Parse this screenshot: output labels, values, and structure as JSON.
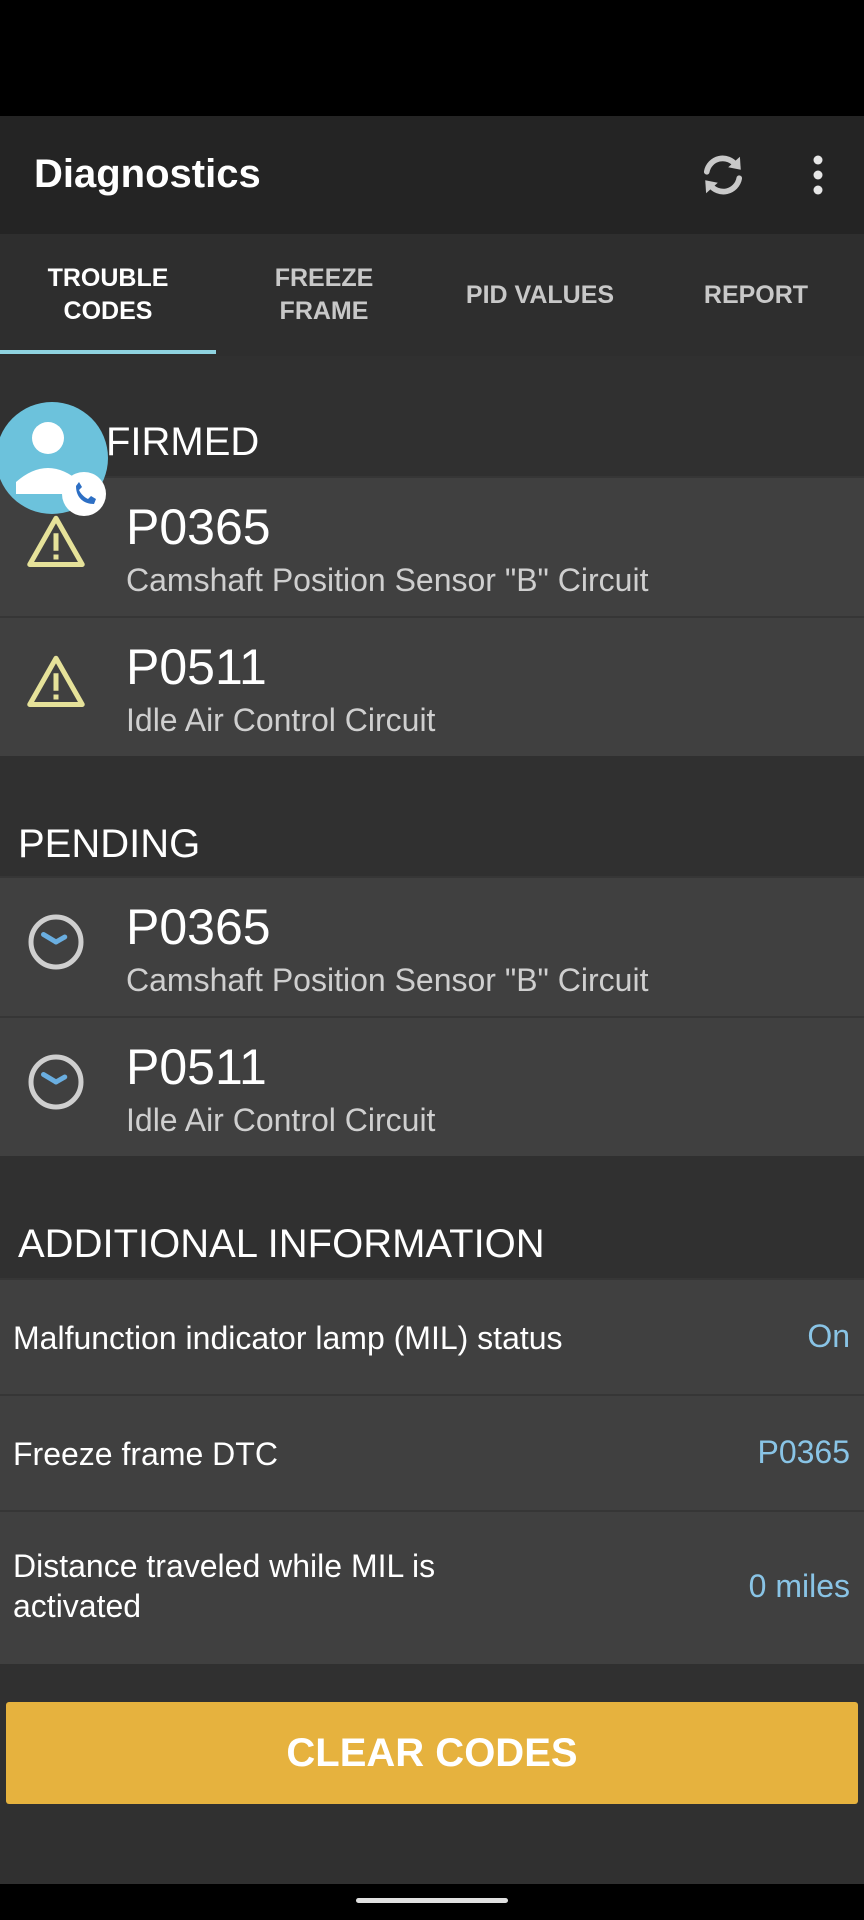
{
  "app_bar": {
    "title": "Diagnostics",
    "refresh_icon": "refresh-icon",
    "more_icon": "more-vert-icon"
  },
  "tabs": [
    {
      "label": "TROUBLE\nCODES",
      "active": true
    },
    {
      "label": "FREEZE\nFRAME",
      "active": false
    },
    {
      "label": "PID VALUES",
      "active": false
    },
    {
      "label": "REPORT",
      "active": false
    }
  ],
  "sections": {
    "confirmed": {
      "title": "FIRMED",
      "items": [
        {
          "code": "P0365",
          "desc": "Camshaft Position Sensor \"B\" Circuit",
          "icon": "warning-icon"
        },
        {
          "code": "P0511",
          "desc": "Idle Air Control Circuit",
          "icon": "warning-icon"
        }
      ]
    },
    "pending": {
      "title": "PENDING",
      "items": [
        {
          "code": "P0365",
          "desc": "Camshaft Position Sensor \"B\" Circuit",
          "icon": "clock-icon"
        },
        {
          "code": "P0511",
          "desc": "Idle Air Control Circuit",
          "icon": "clock-icon"
        }
      ]
    },
    "additional": {
      "title": "ADDITIONAL INFORMATION",
      "rows": [
        {
          "label": "Malfunction indicator lamp (MIL) status",
          "value": "On"
        },
        {
          "label": "Freeze frame DTC",
          "value": "P0365"
        },
        {
          "label": "Distance traveled while MIL is activated",
          "value": "0 miles"
        }
      ]
    }
  },
  "clear_button": {
    "label": "CLEAR CODES"
  },
  "colors": {
    "accent": "#8fd3e0",
    "value": "#89c4e6",
    "button": "#e6b23e",
    "warning": "#e6e29a"
  }
}
